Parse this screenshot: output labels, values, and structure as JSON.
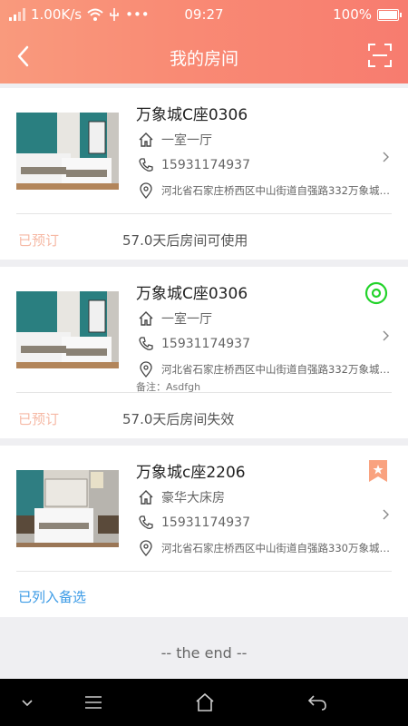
{
  "status_bar": {
    "speed": "1.00K/s",
    "time": "09:27",
    "battery": "100%"
  },
  "header": {
    "title": "我的房间"
  },
  "rooms": [
    {
      "name": "万象城C座0306",
      "type": "一室一厅",
      "phone": "15931174937",
      "address": "河北省石家庄桥西区中山街道自强路332万象城…",
      "status": "已预订",
      "message": "57.0天后房间可使用"
    },
    {
      "name": "万象城C座0306",
      "type": "一室一厅",
      "phone": "15931174937",
      "address": "河北省石家庄桥西区中山街道自强路332万象城…",
      "note": "备注：Asdfgh",
      "status": "已预订",
      "message": "57.0天后房间失效"
    },
    {
      "name": "万象城c座2206",
      "type": "豪华大床房",
      "phone": "15931174937",
      "address": "河北省石家庄桥西区中山街道自强路330万象城…",
      "status": "已列入备选"
    }
  ],
  "footer": {
    "end_text": "-- the end --"
  },
  "colors": {
    "accent": "#f98a74",
    "status_reserved": "#f6b9a5",
    "status_candidate": "#3c9be6",
    "target_green": "#22d32a",
    "bookmark": "#f9a27f"
  }
}
